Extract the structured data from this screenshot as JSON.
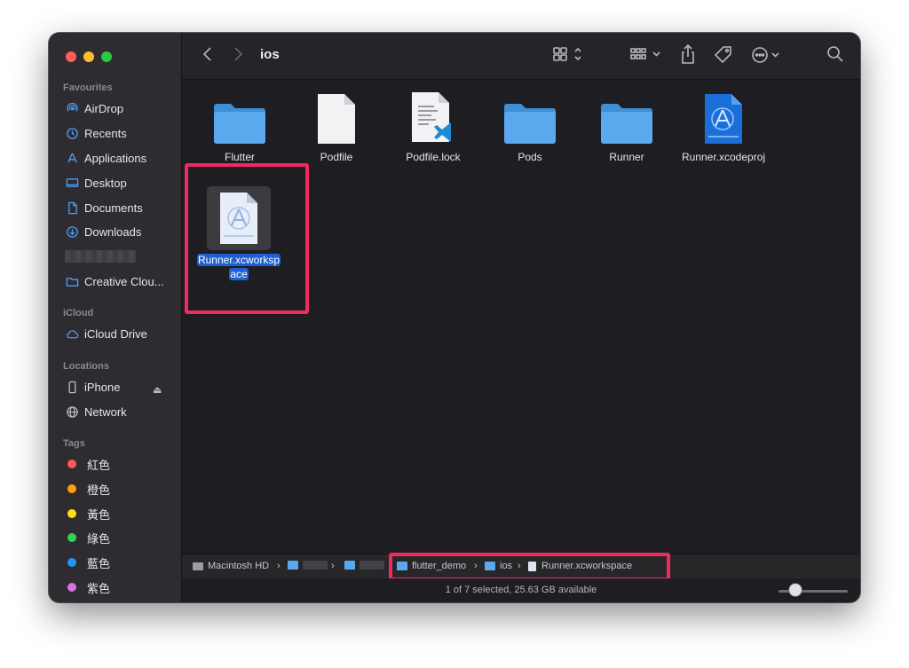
{
  "window": {
    "title": "ios",
    "traffic_lights": {
      "close": "#ff5f57",
      "minimize": "#febc2e",
      "zoom": "#28c840"
    }
  },
  "sidebar": {
    "favourites_heading": "Favourites",
    "favourites": [
      {
        "label": "AirDrop",
        "icon": "airdrop-icon"
      },
      {
        "label": "Recents",
        "icon": "clock-icon"
      },
      {
        "label": "Applications",
        "icon": "applications-icon"
      },
      {
        "label": "Desktop",
        "icon": "desktop-icon"
      },
      {
        "label": "Documents",
        "icon": "document-icon"
      },
      {
        "label": "Downloads",
        "icon": "download-icon"
      },
      {
        "label": "Creative Clou...",
        "icon": "folder-icon"
      }
    ],
    "icloud_heading": "iCloud",
    "icloud": [
      {
        "label": "iCloud Drive",
        "icon": "cloud-icon"
      }
    ],
    "locations_heading": "Locations",
    "locations": [
      {
        "label": "iPhone",
        "icon": "phone-icon"
      },
      {
        "label": "Network",
        "icon": "globe-icon"
      }
    ],
    "tags_heading": "Tags",
    "tags": [
      {
        "label": "紅色",
        "color": "#fc5753"
      },
      {
        "label": "橙色",
        "color": "#fd9f0a"
      },
      {
        "label": "黃色",
        "color": "#fde20a"
      },
      {
        "label": "綠色",
        "color": "#30d158"
      },
      {
        "label": "藍色",
        "color": "#2196f3"
      },
      {
        "label": "紫色",
        "color": "#d772e5"
      }
    ]
  },
  "files": [
    {
      "name": "Flutter",
      "kind": "folder"
    },
    {
      "name": "Podfile",
      "kind": "document"
    },
    {
      "name": "Podfile.lock",
      "kind": "vscode-document"
    },
    {
      "name": "Pods",
      "kind": "folder"
    },
    {
      "name": "Runner",
      "kind": "folder"
    },
    {
      "name": "Runner.xcodeproj",
      "kind": "xcodeproj"
    }
  ],
  "selected_file": {
    "name": "Runner.xcworkspace",
    "label_line1": "Runner.xcworksp",
    "label_line2": "ace"
  },
  "pathbar": {
    "disk": "Macintosh HD",
    "segments": [
      "flutter_demo",
      "ios",
      "Runner.xcworkspace"
    ],
    "separator": "›"
  },
  "status": {
    "text": "1 of 7 selected, 25.63 GB available",
    "icon_size_level": 0.2
  },
  "colors": {
    "highlight": "#f02a62",
    "selection": "#1f5fd2",
    "folder": "#5aa9ef"
  }
}
